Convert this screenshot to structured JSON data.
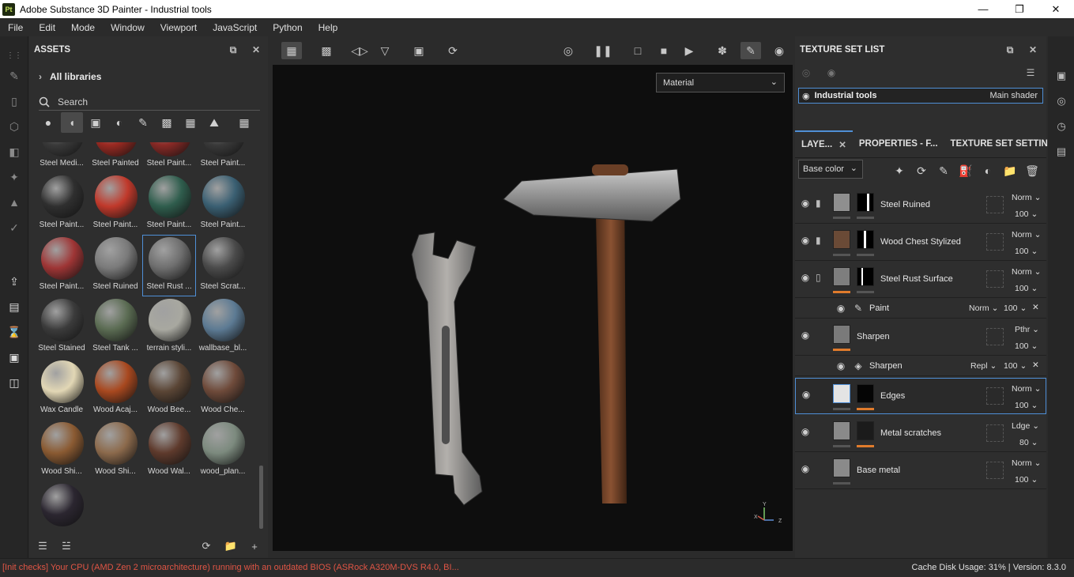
{
  "window": {
    "title": "Adobe Substance 3D Painter - Industrial tools",
    "icon_text": "Pt"
  },
  "menu": [
    "File",
    "Edit",
    "Mode",
    "Window",
    "Viewport",
    "JavaScript",
    "Python",
    "Help"
  ],
  "assets": {
    "title": "ASSETS",
    "library": "All libraries",
    "search_placeholder": "Search",
    "items": [
      {
        "label": "Steel Medi...",
        "color": "#3a3a3a"
      },
      {
        "label": "Steel Painted",
        "color": "#9b2a22"
      },
      {
        "label": "Steel Paint...",
        "color": "#8a2a26"
      },
      {
        "label": "Steel Paint...",
        "color": "#3a3a3a"
      },
      {
        "label": "Steel Paint...",
        "color": "#2f2f2f"
      },
      {
        "label": "Steel Paint...",
        "color": "#c0392b"
      },
      {
        "label": "Steel Paint...",
        "color": "#2f5d4d"
      },
      {
        "label": "Steel Paint...",
        "color": "#3a5f72"
      },
      {
        "label": "Steel Paint...",
        "color": "#9e3535"
      },
      {
        "label": "Steel Ruined",
        "color": "#7a7a7a"
      },
      {
        "label": "Steel Rust ...",
        "color": "#6e6e6e"
      },
      {
        "label": "Steel Scrat...",
        "color": "#4a4a4a"
      },
      {
        "label": "Steel Stained",
        "color": "#3b3b3b"
      },
      {
        "label": "Steel Tank ...",
        "color": "#5a6b52"
      },
      {
        "label": "terrain styli...",
        "color": "#a8a8a0"
      },
      {
        "label": "wallbase_bl...",
        "color": "#5c7a93"
      },
      {
        "label": "Wax Candle",
        "color": "#e2d7b5"
      },
      {
        "label": "Wood Acaj...",
        "color": "#a8481f"
      },
      {
        "label": "Wood Bee...",
        "color": "#5a4535"
      },
      {
        "label": "Wood Che...",
        "color": "#6e4a3a"
      },
      {
        "label": "Wood Shi...",
        "color": "#8a5a32"
      },
      {
        "label": "Wood Shi...",
        "color": "#8c6a4c"
      },
      {
        "label": "Wood Wal...",
        "color": "#5e3a2c"
      },
      {
        "label": "wood_plan...",
        "color": "#7c8a7e"
      },
      {
        "label": "",
        "color": "#2b2630"
      }
    ]
  },
  "viewport": {
    "channel_select": "Material",
    "gizmo": {
      "y": "Y",
      "x": "X",
      "z": "Z"
    }
  },
  "texture_set_list": {
    "title": "TEXTURE SET LIST",
    "item": {
      "name": "Industrial tools",
      "shader": "Main shader"
    }
  },
  "layers": {
    "tabs": [
      "LAYE...",
      "PROPERTIES - F...",
      "TEXTURE SET SETTIN..."
    ],
    "channel": "Base color",
    "rows": [
      {
        "name": "Steel Ruined",
        "blend": "Norm",
        "opacity": "100"
      },
      {
        "name": "Wood Chest Stylized",
        "blend": "Norm",
        "opacity": "100"
      },
      {
        "name": "Steel Rust Surface",
        "blend": "Norm",
        "opacity": "100"
      },
      {
        "name": "Paint",
        "blend": "Norm",
        "opacity": "100"
      },
      {
        "name": "Sharpen",
        "blend": "Pthr",
        "opacity": "100"
      },
      {
        "name": "Sharpen",
        "blend": "Repl",
        "opacity": "100"
      },
      {
        "name": "Edges",
        "blend": "Norm",
        "opacity": "100"
      },
      {
        "name": "Metal scratches",
        "blend": "Ldge",
        "opacity": "80"
      },
      {
        "name": "Base metal",
        "blend": "Norm",
        "opacity": "100"
      }
    ]
  },
  "status": {
    "message": "[Init checks] Your CPU (AMD Zen 2 microarchitecture) running with an outdated BIOS (ASRock A320M-DVS R4.0, BI...",
    "right": "Cache Disk Usage:   31% | Version: 8.3.0"
  },
  "colors": {
    "accent": "#4f8fd6",
    "warning": "#e05545",
    "mask_bar": "#e07b2c"
  }
}
